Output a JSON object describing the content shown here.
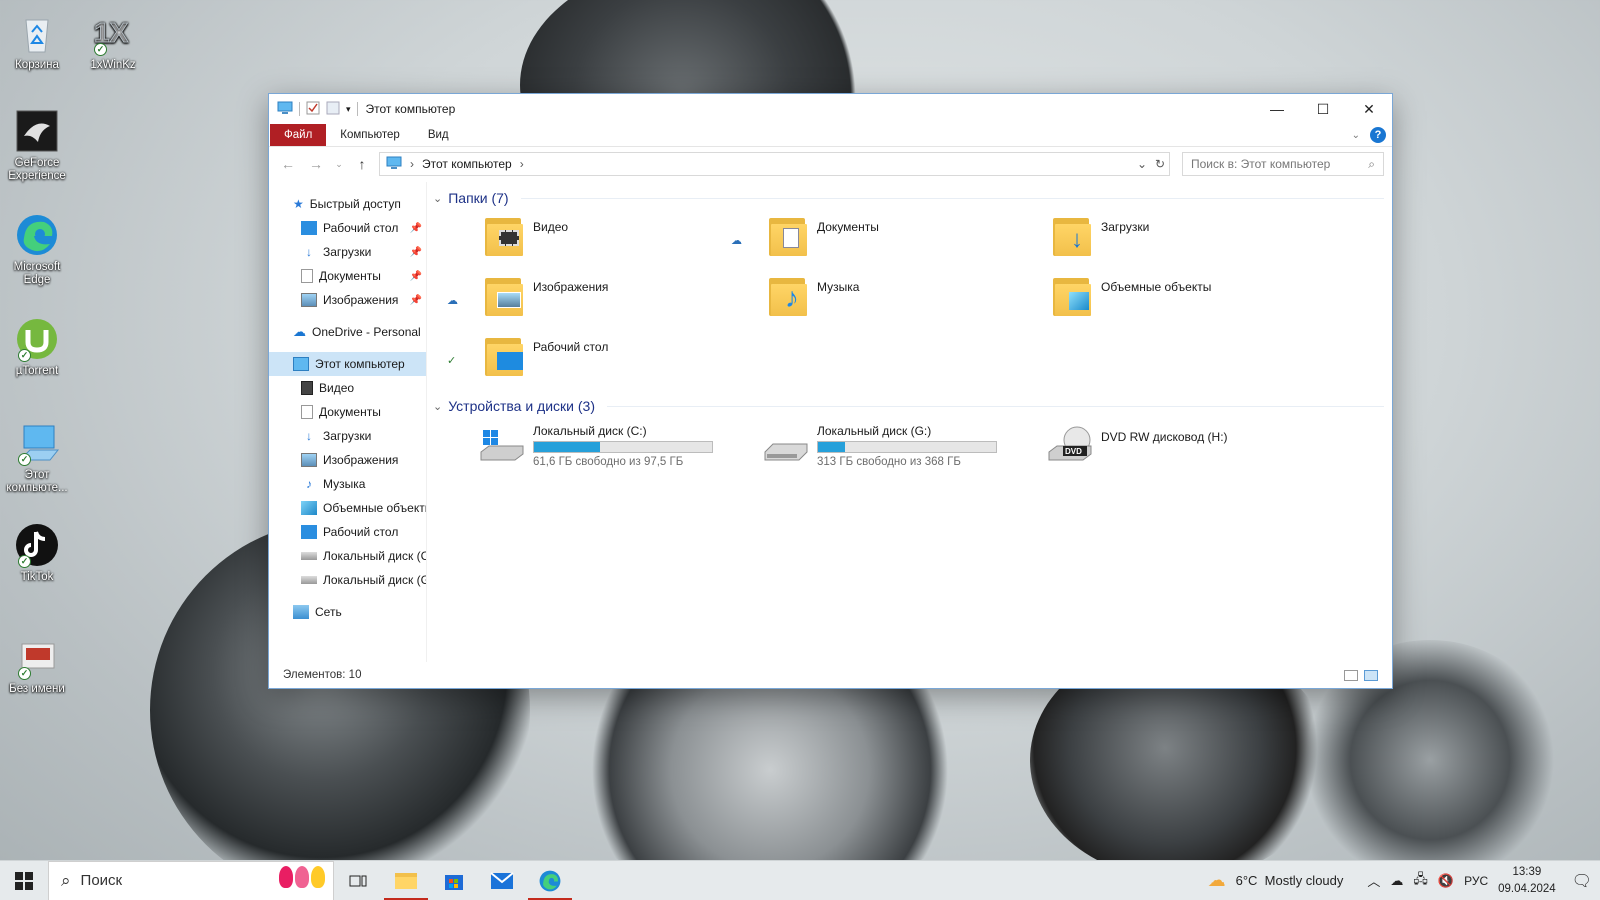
{
  "desktop": {
    "icons": [
      {
        "label": "Корзина"
      },
      {
        "label": "1xWinKz"
      },
      {
        "label": "GeForce Experience"
      },
      {
        "label": "Microsoft Edge"
      },
      {
        "label": "µTorrent"
      },
      {
        "label": "Этот компьюте..."
      },
      {
        "label": "TikTok"
      },
      {
        "label": "Без имени"
      }
    ]
  },
  "window": {
    "title": "Этот компьютер",
    "ribbon_tabs": [
      "Файл",
      "Компьютер",
      "Вид"
    ],
    "help": "?",
    "address": {
      "location": "Этот компьютер"
    },
    "search": {
      "placeholder": "Поиск в: Этот компьютер"
    }
  },
  "navpane": {
    "quick_access": "Быстрый доступ",
    "quick_items": [
      "Рабочий стол",
      "Загрузки",
      "Документы",
      "Изображения"
    ],
    "onedrive": "OneDrive - Personal",
    "this_pc": "Этот компьютер",
    "pc_items": [
      "Видео",
      "Документы",
      "Загрузки",
      "Изображения",
      "Музыка",
      "Объемные объекты",
      "Рабочий стол",
      "Локальный диск (C:)",
      "Локальный диск (G:)"
    ],
    "network": "Сеть"
  },
  "content": {
    "folders_header": "Папки (7)",
    "folders": [
      {
        "name": "Видео",
        "status": ""
      },
      {
        "name": "Документы",
        "status": "cloud"
      },
      {
        "name": "Загрузки",
        "status": ""
      },
      {
        "name": "Изображения",
        "status": "cloud"
      },
      {
        "name": "Музыка",
        "status": ""
      },
      {
        "name": "Объемные объекты",
        "status": ""
      },
      {
        "name": "Рабочий стол",
        "status": "synced"
      }
    ],
    "devices_header": "Устройства и диски (3)",
    "drives": [
      {
        "name": "Локальный диск (C:)",
        "free": "61,6 ГБ свободно из 97,5 ГБ",
        "used_fraction": 0.37
      },
      {
        "name": "Локальный диск (G:)",
        "free": "313 ГБ свободно из 368 ГБ",
        "used_fraction": 0.15
      },
      {
        "name": "DVD RW дисковод (H:)"
      }
    ]
  },
  "statusbar": {
    "items": "Элементов: 10"
  },
  "taskbar": {
    "search_placeholder": "Поиск",
    "weather": "6°C  Mostly cloudy",
    "lang": "РУС",
    "time": "13:39",
    "date": "09.04.2024"
  },
  "colors": {
    "file_tab": "#b01f24",
    "accent": "#26a0da",
    "selection": "#cce4f7",
    "group_header": "#1e3287"
  }
}
